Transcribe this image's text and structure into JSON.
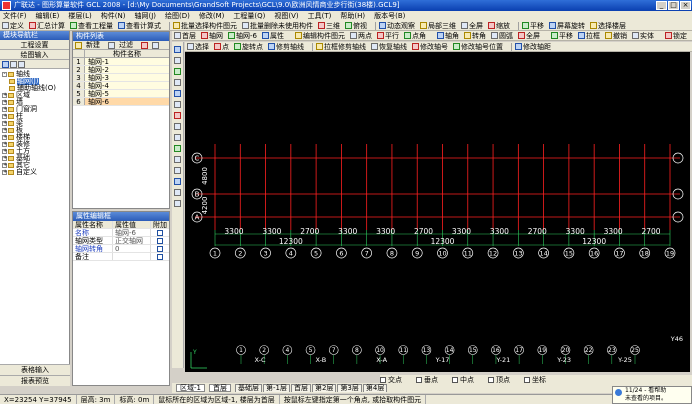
{
  "window": {
    "title": "广联达 - 图形算量软件 GCL 2008 - [d:\\My Documents\\GrandSoft Projects\\GCL\\9.0\\欧洲风情商业步行街(38楼).GCL9]"
  },
  "menu": [
    "文件(F)",
    "编辑(E)",
    "楼层(L)",
    "构件(N)",
    "轴网(J)",
    "绘图(D)",
    "修改(M)",
    "工程量(Q)",
    "视图(V)",
    "工具(T)",
    "帮助(H)",
    "版本号(B)"
  ],
  "toolbar1": [
    "定义",
    "汇总计算",
    "查看工程量",
    "查看计算式",
    "批量选择构件图元",
    "批量删除未使用构件",
    "三维",
    "俯视",
    "动态观察",
    "局部三维",
    "全屏",
    "缩放",
    "平移",
    "屏幕旋转",
    "选择楼层"
  ],
  "toolbar2": [
    "首层",
    "轴网",
    "轴网-6",
    "属性",
    "编辑构件图元",
    "两点",
    "平行",
    "点角",
    "轴角",
    "转角",
    "圆弧",
    "全屏",
    "平移",
    "拉框",
    "撤销",
    "实体",
    "锁定"
  ],
  "toolbar3": [
    "选择",
    "点",
    "旋转点",
    "修剪轴线",
    "拉框修剪轴线",
    "恢复轴线",
    "修改轴号",
    "修改轴号位置",
    "修改轴距"
  ],
  "sidebar": {
    "header": "模块导航栏",
    "btn_settings": "工程设置",
    "btn_draw": "绘图输入",
    "tree": [
      {
        "label": "轴线",
        "level": 0,
        "expand": "-"
      },
      {
        "label": "轴网(J)",
        "level": 1,
        "selected": true
      },
      {
        "label": "辅助轴线(O)",
        "level": 1
      },
      {
        "label": "区域",
        "level": 0,
        "expand": "+"
      },
      {
        "label": "墙",
        "level": 0,
        "expand": "+"
      },
      {
        "label": "门窗洞",
        "level": 0,
        "expand": "+"
      },
      {
        "label": "柱",
        "level": 0,
        "expand": "+"
      },
      {
        "label": "梁",
        "level": 0,
        "expand": "+"
      },
      {
        "label": "板",
        "level": 0,
        "expand": "+"
      },
      {
        "label": "楼梯",
        "level": 0,
        "expand": "+"
      },
      {
        "label": "装修",
        "level": 0,
        "expand": "+"
      },
      {
        "label": "土方",
        "level": 0,
        "expand": "+"
      },
      {
        "label": "基础",
        "level": 0,
        "expand": "+"
      },
      {
        "label": "其它",
        "level": 0,
        "expand": "+"
      },
      {
        "label": "自定义",
        "level": 0,
        "expand": "+"
      }
    ],
    "btn_table": "表格输入",
    "btn_report": "报表预览"
  },
  "component_list": {
    "header": "构件列表",
    "new_label": "新建",
    "filter_label": "过滤",
    "col_name": "构件名称",
    "rows": [
      {
        "num": "1",
        "name": "轴网-1"
      },
      {
        "num": "2",
        "name": "轴网-2"
      },
      {
        "num": "3",
        "name": "轴网-3"
      },
      {
        "num": "4",
        "name": "轴网-4"
      },
      {
        "num": "5",
        "name": "轴网-5"
      },
      {
        "num": "6",
        "name": "轴网-6",
        "selected": true
      }
    ]
  },
  "properties": {
    "header": "属性编辑框",
    "col_name": "属性名称",
    "col_value": "属性值",
    "col_extra": "附加",
    "rows": [
      {
        "name": "名称",
        "value": "轴网-6",
        "blue": true
      },
      {
        "name": "轴网类型",
        "value": "正交轴网"
      },
      {
        "name": "轴网转角",
        "value": "0",
        "blue": true
      },
      {
        "name": "备注",
        "value": ""
      }
    ]
  },
  "canvas": {
    "bg_color": "#000000",
    "grid_color": "#ff2020",
    "axis_color": "#30d060",
    "text_color": "#ffffff",
    "left_axis_labels": [
      "C",
      "B",
      "A"
    ],
    "left_spacings": [
      "4800",
      "4200"
    ],
    "dim_top": [
      "3300",
      "3300",
      "2700",
      "3300",
      "3300",
      "2700",
      "3300",
      "3300",
      "2700",
      "3300",
      "3300",
      "2700"
    ],
    "dim_totals": [
      "12300",
      "12300",
      "12300"
    ],
    "top_axis_labels": [
      "1",
      "2",
      "3",
      "4",
      "5",
      "6",
      "7",
      "8",
      "9",
      "10",
      "11",
      "12",
      "13",
      "14",
      "15",
      "16",
      "17",
      "18",
      "19"
    ],
    "bottom_axis_labels": [
      "1",
      "2",
      "4",
      "5",
      "7",
      "8",
      "10",
      "11",
      "13",
      "14",
      "15",
      "16",
      "17",
      "19",
      "20",
      "22",
      "23",
      "25"
    ],
    "bottom_sub_labels": [
      "X-C",
      "X-B",
      "X-A",
      "Y-17",
      "Y-21",
      "Y-23",
      "Y-25"
    ],
    "corner_label": "Y46",
    "axis_marker": "Y"
  },
  "snapbar": [
    "交点",
    "垂点",
    "中点",
    "顶点",
    "坐标"
  ],
  "bottom": {
    "region_value": "区域-1",
    "type_value": "首层",
    "tabs": [
      "基础层",
      "第-1层",
      "首层",
      "第2层",
      "第3层",
      "第4层"
    ]
  },
  "status": {
    "coords": "X=23254 Y=37945",
    "floor_height": "层高: 3m",
    "elevation": "标高: 0m",
    "hint1": "鼠标所在的区域为区域-1, 楼层为首层",
    "hint2": "按鼠标左键指定第一个角点, 或拾取构件图元"
  },
  "popup": {
    "line1": "11/24 - 看帮助",
    "line2": "未查看的项目。"
  }
}
